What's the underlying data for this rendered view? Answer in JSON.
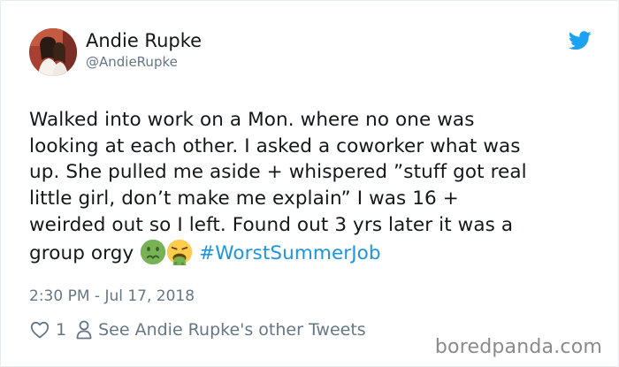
{
  "author": {
    "display_name": "Andie Rupke",
    "handle": "@AndieRupke"
  },
  "tweet": {
    "lines": [
      "Walked into work on a Mon. where no one was",
      "looking at each other. I asked a coworker what was",
      "up. She pulled me aside + whispered ”stuff got real",
      "little girl, don’t make me explain” I was 16 +",
      "weirded out so I left. Found out 3 yrs later it was a"
    ],
    "last_line_text": "group orgy",
    "emojis": [
      "nauseated-face-icon",
      "vomiting-face-icon"
    ],
    "hashtag": "#WorstSummerJob",
    "timestamp": "2:30 PM - Jul 17, 2018"
  },
  "actions": {
    "like_count": "1",
    "other_tweets_label": "See Andie Rupke's other Tweets"
  },
  "watermark": "boredpanda.com",
  "colors": {
    "hashtag": "#1b95e0",
    "twitter_blue": "#1da1f2",
    "secondary_text": "#657786"
  }
}
